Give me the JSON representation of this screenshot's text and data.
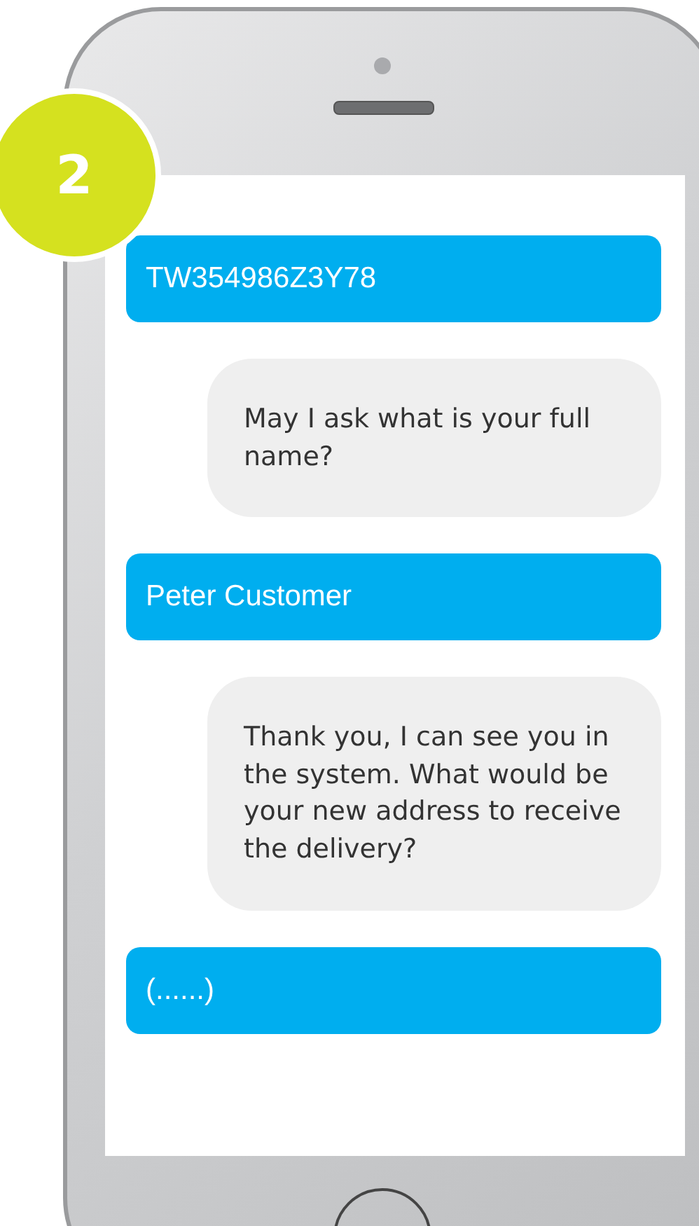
{
  "step_badge": "2",
  "messages": [
    {
      "kind": "user",
      "text": "TW354986Z3Y78"
    },
    {
      "kind": "agent",
      "text": "May I ask what is your full name?"
    },
    {
      "kind": "user",
      "text": "Peter Customer"
    },
    {
      "kind": "agent",
      "text": "Thank you, I can see you in the system. What would be your new address to receive the delivery?"
    },
    {
      "kind": "user",
      "text": "(......)"
    }
  ]
}
